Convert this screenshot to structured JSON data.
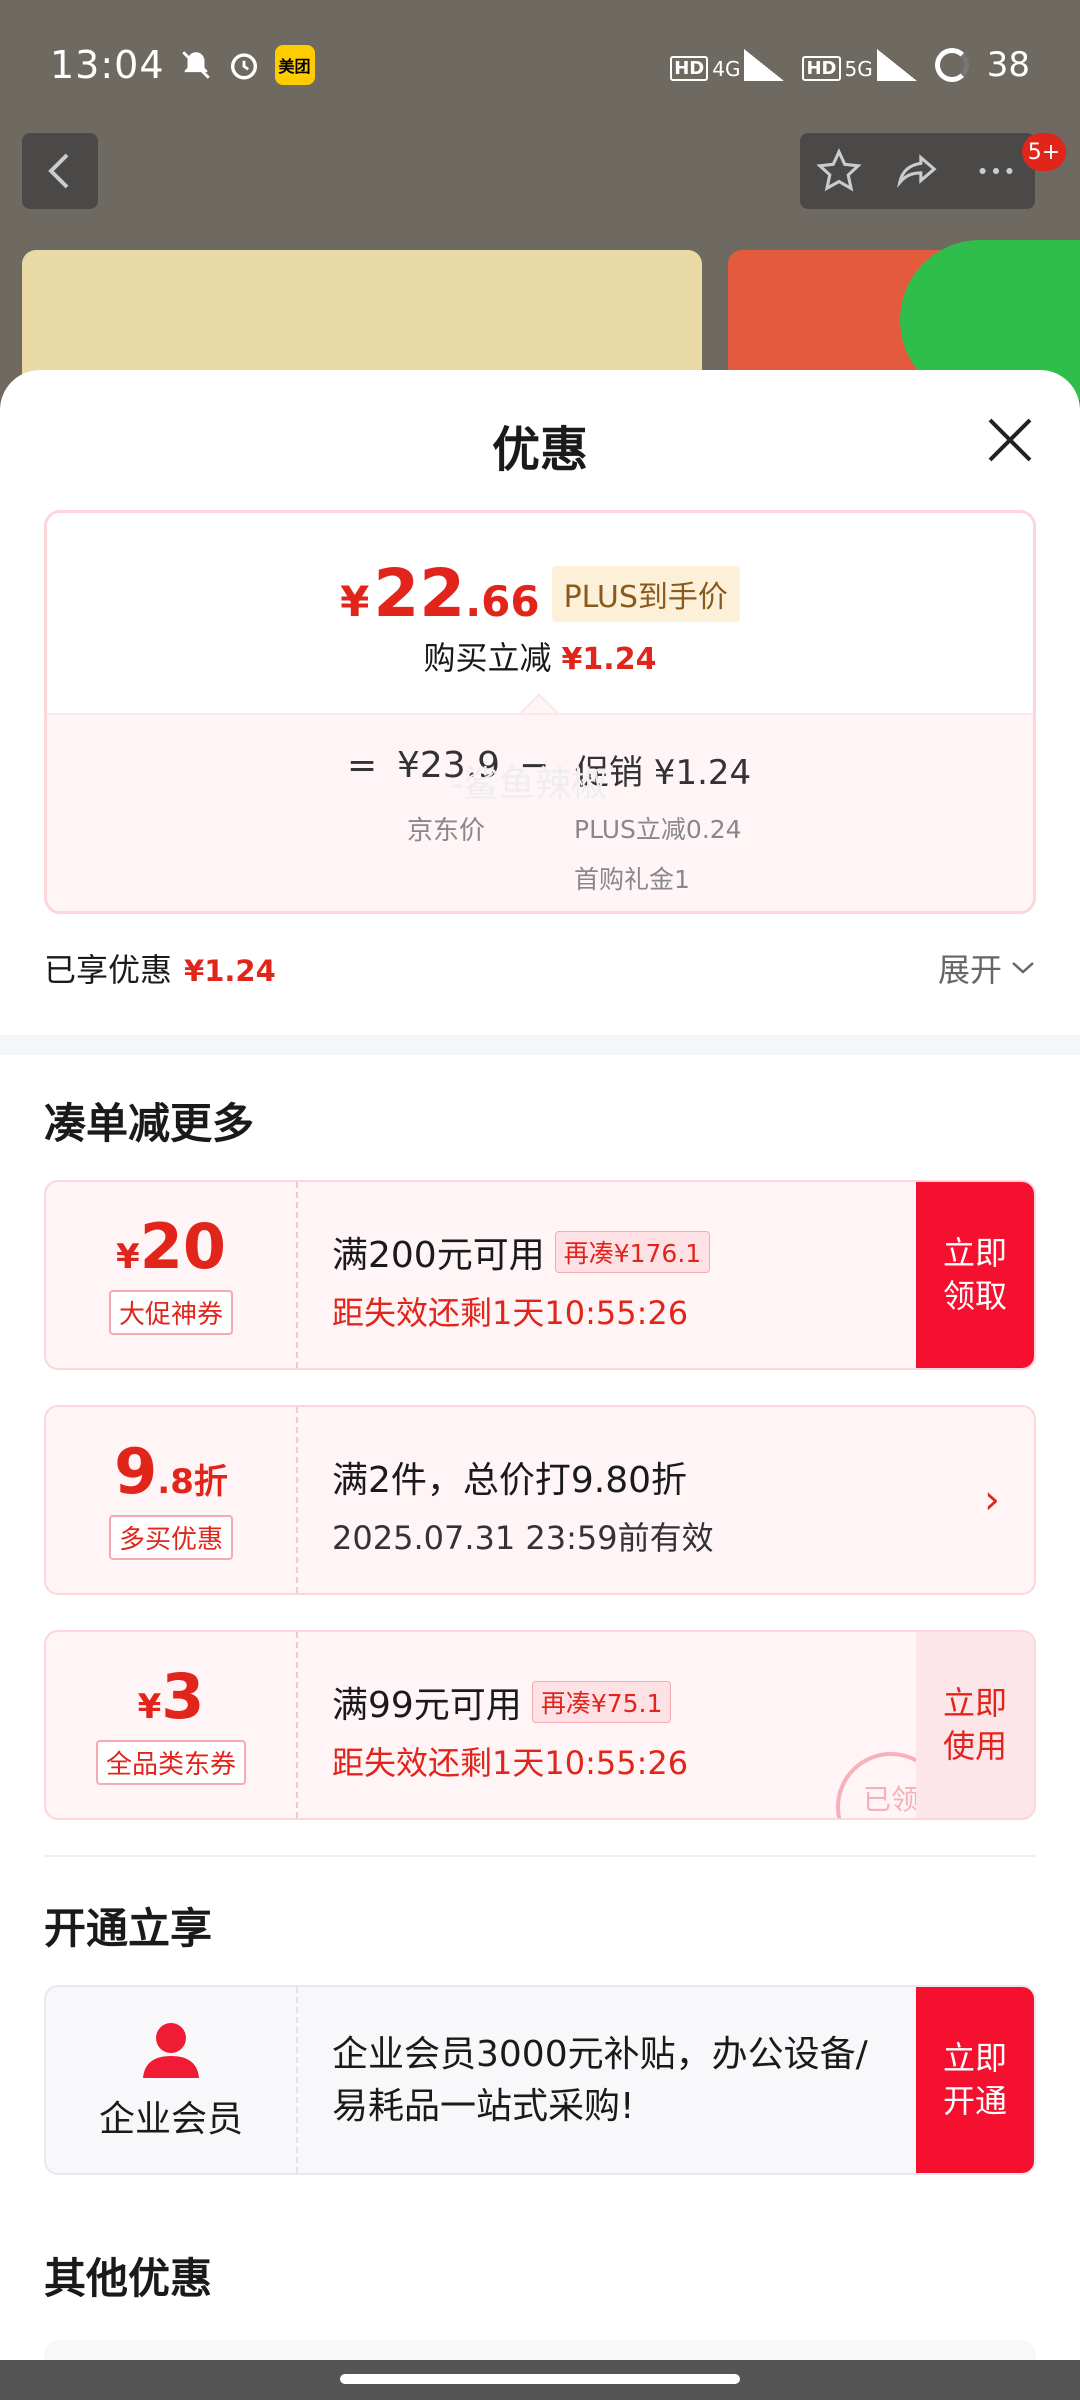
{
  "status_bar": {
    "time": "13:04",
    "battery": "38",
    "net1": "4G",
    "net2": "5G",
    "app_badge": "美团"
  },
  "nav": {
    "more_badge": "5+"
  },
  "sheet": {
    "title": "优惠",
    "price_card": {
      "final_currency": "¥",
      "final_int": "22",
      "final_dec": ".66",
      "plus_tag": "PLUS到手价",
      "instant_cut_label": "购买立减",
      "instant_cut_value": "¥1.24",
      "eq": "=",
      "jd_price": "¥23.9",
      "minus": "−",
      "promo": "促销 ¥1.24",
      "jd_label": "京东价",
      "plus_cut": "PLUS立减0.24",
      "first_gift": "首购礼金1"
    },
    "enjoyed_label": "已享优惠",
    "enjoyed_value": "¥1.24",
    "expand_label": "展开",
    "section_more": "凑单减更多",
    "coupons": [
      {
        "currency": "¥",
        "amount": "20",
        "tag": "大促神券",
        "line1": "满200元可用",
        "small_tag": "再凑¥176.1",
        "line2": "距失效还剩1天10:55:26",
        "btn": "立即\n领取"
      },
      {
        "amount_big": "9",
        "amount_small": ".8折",
        "tag": "多买优惠",
        "line1": "满2件，总价打9.80折",
        "line2": "2025.07.31 23:59前有效",
        "arrow": "›"
      },
      {
        "currency": "¥",
        "amount": "3",
        "tag": "全品类东券",
        "line1": "满99元可用",
        "small_tag": "再凑¥75.1",
        "line2": "距失效还剩1天10:55:26",
        "btn": "立即\n使用",
        "stamp": "已领"
      }
    ],
    "section_open": "开通立享",
    "member": {
      "label": "企业会员",
      "text": "企业会员3000元补贴，办公设备/易耗品一站式采购!",
      "btn": "立即\n开通"
    },
    "section_other": "其他优惠"
  },
  "watermark": "-鲨鱼辣椒"
}
